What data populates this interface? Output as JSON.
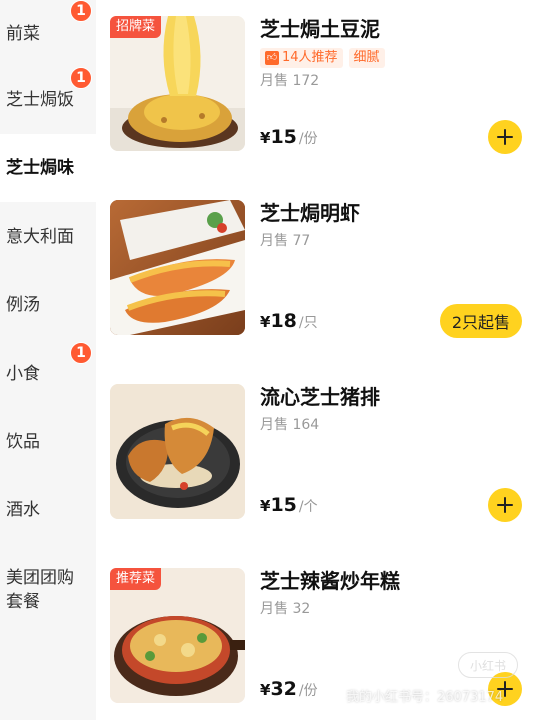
{
  "sidebar": {
    "categories": [
      {
        "label": "前菜",
        "badge": "1"
      },
      {
        "label": "芝士焗饭",
        "badge": "1"
      },
      {
        "label": "芝士焗味",
        "badge": ""
      },
      {
        "label": "意大利面",
        "badge": ""
      },
      {
        "label": "例汤",
        "badge": ""
      },
      {
        "label": "小食",
        "badge": "1"
      },
      {
        "label": "饮品",
        "badge": ""
      },
      {
        "label": "酒水",
        "badge": ""
      },
      {
        "label_line1": "美团团购",
        "label_line2": "套餐",
        "badge": ""
      }
    ],
    "active_index": 2
  },
  "items": [
    {
      "name": "芝士焗土豆泥",
      "corner_tag": "招牌菜",
      "tags": [
        {
          "text": "14人推荐",
          "icon": "thumb-up-icon"
        },
        {
          "text": "细腻"
        }
      ],
      "sales": "月售 172",
      "price_symbol": "¥",
      "price": "15",
      "unit": "/份",
      "action": "add"
    },
    {
      "name": "芝士焗明虾",
      "sales": "月售 77",
      "price_symbol": "¥",
      "price": "18",
      "unit": "/只",
      "action": "min",
      "action_label": "2只起售"
    },
    {
      "name": "流心芝士猪排",
      "sales": "月售 164",
      "price_symbol": "¥",
      "price": "15",
      "unit": "/个",
      "action": "add"
    },
    {
      "name": "芝士辣酱炒年糕",
      "corner_tag": "推荐菜",
      "sales": "月售 32",
      "price_symbol": "¥",
      "price": "32",
      "unit": "/份",
      "action": "add"
    }
  ],
  "watermark": {
    "text": "我的小红书号：26073174",
    "logo": "小红书"
  },
  "colors": {
    "accent": "#ffd21f",
    "badge": "#ff5a32",
    "tag_text": "#ff6a2b",
    "corner_tag": "#f5533d"
  }
}
